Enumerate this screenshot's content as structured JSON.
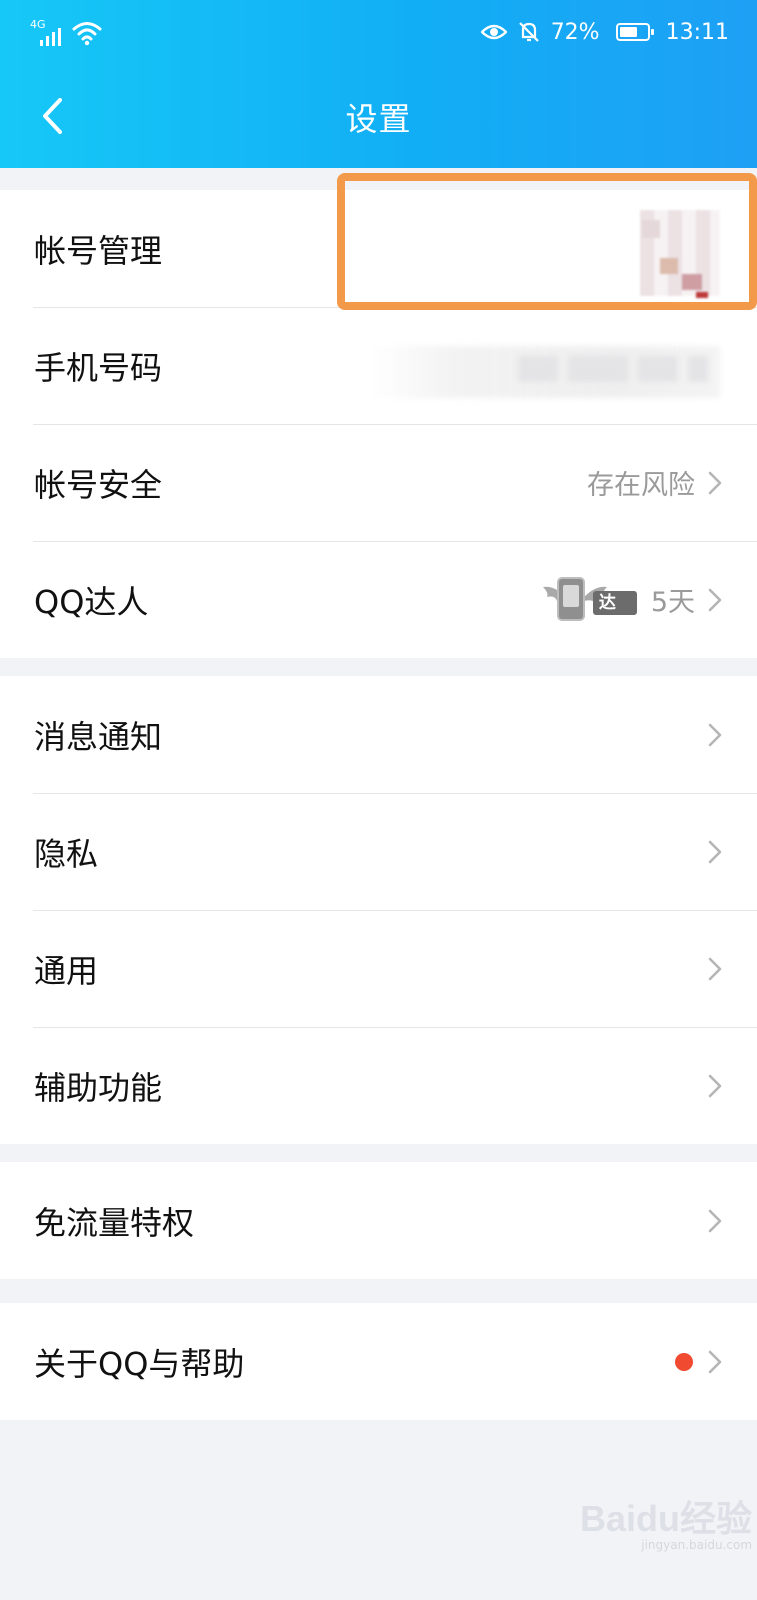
{
  "status_bar": {
    "network_type": "4G",
    "battery_percent": "72%",
    "battery_level": 0.72,
    "time": "13:11",
    "icons": [
      "signal-icon",
      "wifi-icon",
      "eye-care-icon",
      "mute-bell-icon",
      "battery-icon"
    ]
  },
  "header": {
    "title": "设置",
    "back_icon": "chevron-left-icon",
    "background_colors": [
      "#16c8f7",
      "#1ea0f5"
    ]
  },
  "groups": [
    {
      "rows": [
        {
          "label": "帐号管理",
          "value": "",
          "has_chevron": false
        },
        {
          "label": "手机号码",
          "value": "",
          "has_chevron": false
        },
        {
          "label": "帐号安全",
          "value": "存在风险",
          "has_chevron": true
        },
        {
          "label": "QQ达人",
          "value": "5天",
          "badge": "达人",
          "has_chevron": true
        }
      ]
    },
    {
      "rows": [
        {
          "label": "消息通知",
          "has_chevron": true
        },
        {
          "label": "隐私",
          "has_chevron": true
        },
        {
          "label": "通用",
          "has_chevron": true
        },
        {
          "label": "辅助功能",
          "has_chevron": true
        }
      ]
    },
    {
      "rows": [
        {
          "label": "免流量特权",
          "has_chevron": true
        }
      ]
    },
    {
      "rows": [
        {
          "label": "关于QQ与帮助",
          "has_chevron": true,
          "red_dot": true
        }
      ]
    }
  ],
  "highlight_color": "#f29a4a",
  "watermark": {
    "main": "Baidu经验",
    "sub": "jingyan.baidu.com"
  }
}
